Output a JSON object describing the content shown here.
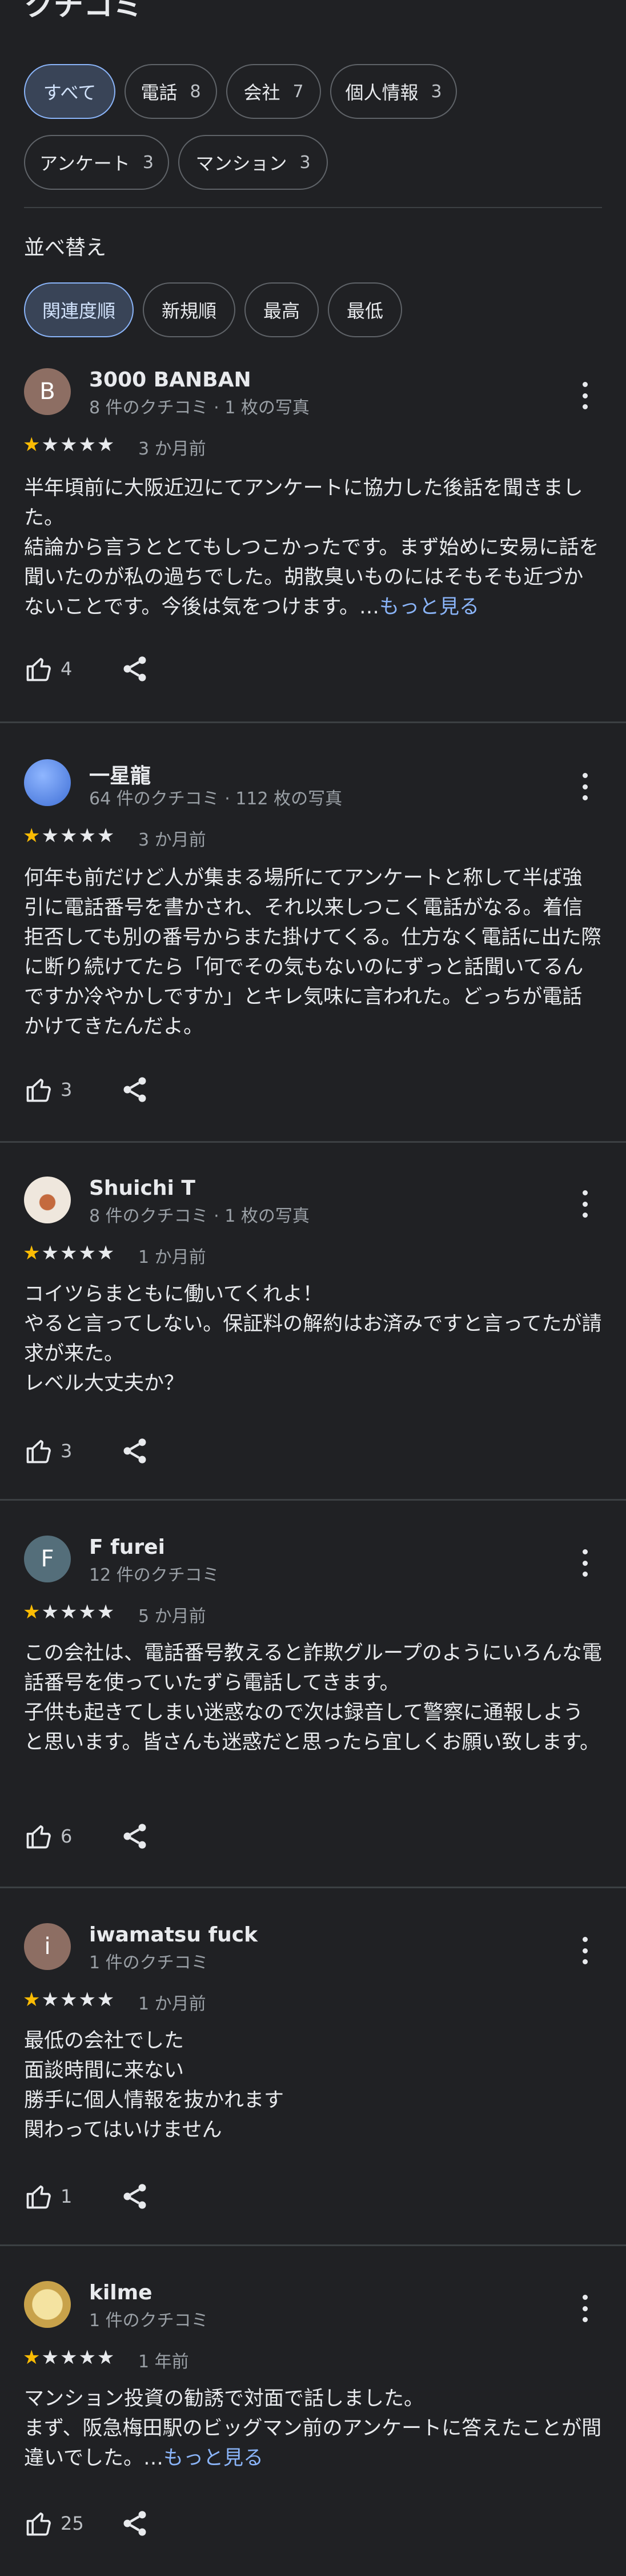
{
  "header": {
    "title": "クチコミ"
  },
  "filters": [
    {
      "label": "すべて",
      "count": ""
    },
    {
      "label": "電話",
      "count": "8"
    },
    {
      "label": "会社",
      "count": "7"
    },
    {
      "label": "個人情報",
      "count": "3"
    },
    {
      "label": "アンケート",
      "count": "3"
    },
    {
      "label": "マンション",
      "count": "3"
    }
  ],
  "sort": {
    "label": "並べ替え",
    "options": [
      "関連度順",
      "新規順",
      "最高",
      "最低"
    ],
    "selected": "関連度順"
  },
  "reviews": [
    {
      "avatar_letter": "B",
      "avatar_color": "#8d6e63",
      "name": "3000 BANBAN",
      "meta": "8 件のクチコミ · 1 枚の写真",
      "stars": 1,
      "ago": "3 か月前",
      "lines": [
        "半年頃前に大阪近辺にてアンケートに協力した後話を聞きました。",
        "結論から言うととてもしつこかったです。まず始めに安易に話を聞いたのが私の過ちでした。胡散臭いものにはそもそも近づかないことです。今後は気をつけます。…"
      ],
      "more": "もっと見る",
      "likes": "4"
    },
    {
      "avatar_letter": "",
      "avatar_color": "#5b8def",
      "name": "一星龍",
      "meta": "64 件のクチコミ · 112 枚の写真",
      "stars": 1,
      "ago": "3 か月前",
      "lines": [
        "何年も前だけど人が集まる場所にてアンケートと称して半ば強引に電話番号を書かされ、それ以来しつこく電話がなる。着信拒否しても別の番号からまた掛けてくる。仕方なく電話に出た際に断り続けてたら「何でその気もないのにずっと話聞いてるんですか冷やかしですか」とキレ気味に言われた。どっちが電話かけてきたんだよ。"
      ],
      "more": "",
      "likes": "3"
    },
    {
      "avatar_letter": "",
      "avatar_color": "#d7ccc8",
      "name": "Shuichi T",
      "meta": "8 件のクチコミ · 1 枚の写真",
      "stars": 1,
      "ago": "1 か月前",
      "lines": [
        "コイツらまともに働いてくれよ！",
        "やると言ってしない。保証料の解約はお済みですと言ってたが請求が来た。",
        "レベル大丈夫か？"
      ],
      "more": "",
      "likes": "3"
    },
    {
      "avatar_letter": "F",
      "avatar_color": "#546e7a",
      "name": "F furei",
      "meta": "12 件のクチコミ",
      "stars": 1,
      "ago": "5 か月前",
      "lines": [
        "この会社は、電話番号教えると詐欺グループのようにいろんな電話番号を使っていたずら電話してきます。",
        "子供も起きてしまい迷惑なので次は録音して警察に通報しようと思います。皆さんも迷惑だと思ったら宜しくお願い致します。"
      ],
      "more": "",
      "likes": "6"
    },
    {
      "avatar_letter": "i",
      "avatar_color": "#8d6e63",
      "name": "iwamatsu fuck",
      "meta": "1 件のクチコミ",
      "stars": 1,
      "ago": "1 か月前",
      "lines": [
        "最低の会社でした",
        "面談時間に来ない",
        "勝手に個人情報を抜かれます",
        "関わってはいけません"
      ],
      "more": "",
      "likes": "1"
    },
    {
      "avatar_letter": "",
      "avatar_color": "#c8a24a",
      "name": "kilme",
      "meta": "1 件のクチコミ",
      "stars": 1,
      "ago": "1 年前",
      "lines": [
        "マンション投資の勧誘で対面で話しました。",
        "まず、阪急梅田駅のビッグマン前のアンケートに答えたことが間違いでした。…"
      ],
      "more": "もっと見る",
      "likes": "25"
    }
  ]
}
